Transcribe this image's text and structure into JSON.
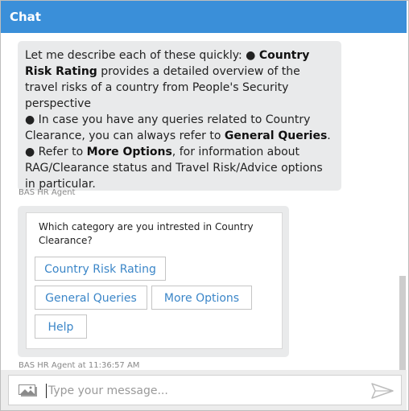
{
  "header": {
    "title": "Chat"
  },
  "message1": {
    "intro": "Let me describe each of these quickly: ● ",
    "bold1": "Country Risk Rating",
    "text1": " provides a detailed overview of the travel risks of a country from People's Security perspective",
    "bullet2": "● In case you have any queries related to Country Clearance, you can always refer to ",
    "bold2": "General Queries",
    "dot": ".",
    "bullet3": "● Refer to ",
    "bold3": "More Options",
    "text3": ", for information about RAG/Clearance status and Travel Risk/Advice options in particular.",
    "sender": "BAS HR Agent"
  },
  "message2": {
    "question": "Which category are you intrested in Country Clearance?",
    "buttons": [
      "Country Risk Rating",
      "General Queries",
      "More Options",
      "Help"
    ],
    "sender": "BAS HR Agent at 11:36:57 AM"
  },
  "input": {
    "placeholder": "Type your message...",
    "icons": {
      "attach": "image-icon",
      "send": "send-icon"
    }
  },
  "colors": {
    "header": "#3a8fd9",
    "button_text": "#3b86c8",
    "bubble": "#e9eaeb"
  }
}
